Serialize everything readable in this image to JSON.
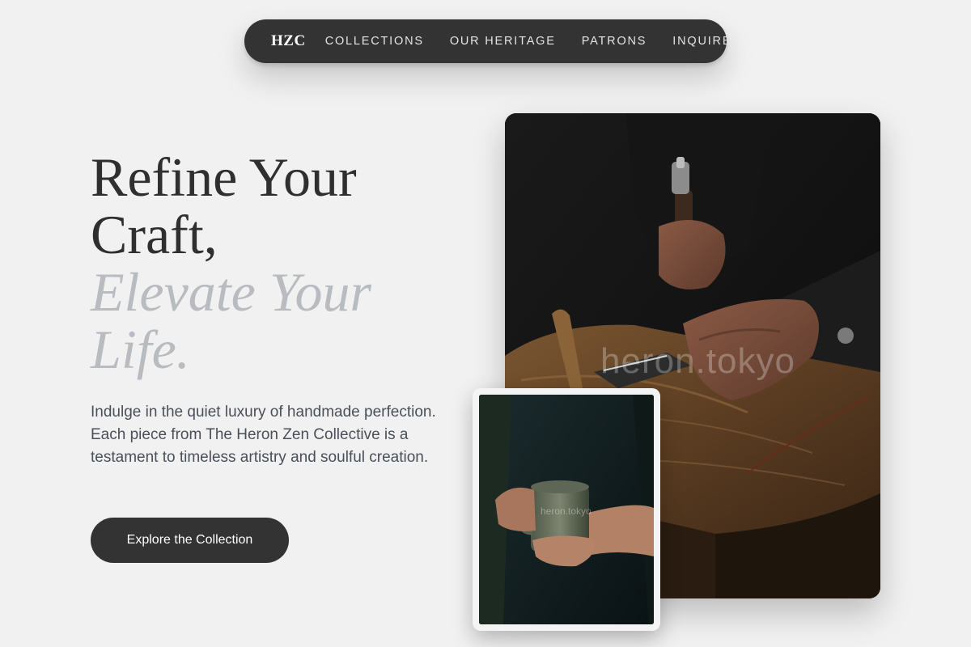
{
  "nav": {
    "logo": "HZC",
    "links": [
      "COLLECTIONS",
      "OUR HERITAGE",
      "PATRONS",
      "INQUIRE"
    ]
  },
  "hero": {
    "headline_lines": [
      "Refine Your",
      "Craft,"
    ],
    "accent_lines": [
      "Elevate Your",
      "Life."
    ],
    "description": "Indulge in the quiet luxury of handmade perfection. Each piece from The Heron Zen Collective is a testament to timeless artistry and soulful creation.",
    "cta_label": "Explore the Collection"
  },
  "images": {
    "main_watermark": "heron.tokyo",
    "small_watermark": "heron.tokyo"
  },
  "colors": {
    "background": "#f1f1f1",
    "nav_background": "#333333",
    "headline": "#2f2f2f",
    "accent": "#b8bcc1",
    "body_text": "#4a5059",
    "button": "#333333"
  }
}
